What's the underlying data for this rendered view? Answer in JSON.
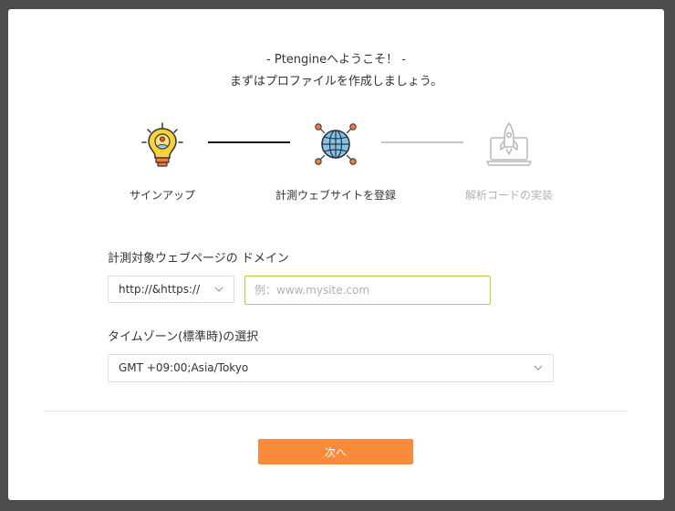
{
  "header": {
    "welcome": "- Ptengineへようこそ！ -",
    "subtitle": "まずはプロファイルを作成しましょう。"
  },
  "steps": [
    {
      "label": "サインアップ",
      "icon": "lightbulb-icon",
      "state": "done"
    },
    {
      "label": "計測ウェブサイトを登録",
      "icon": "globe-icon",
      "state": "active"
    },
    {
      "label": "解析コードの実装",
      "icon": "laptop-rocket-icon",
      "state": "pending"
    }
  ],
  "domain": {
    "label": "計測対象ウェブページの ドメイン",
    "protocol_value": "http://&https://",
    "placeholder": "例：www.mysite.com",
    "value": ""
  },
  "timezone": {
    "label": "タイムゾーン(標準時)の選択",
    "value": "GMT +09:00;Asia/Tokyo"
  },
  "actions": {
    "next_label": "次へ"
  },
  "colors": {
    "accent": "#fa8b3c",
    "input_focus_border": "#b4d33b",
    "connector_done": "#1a1a1a",
    "connector_pending": "#c8c8c8",
    "inactive_text": "#b3b3b3"
  }
}
